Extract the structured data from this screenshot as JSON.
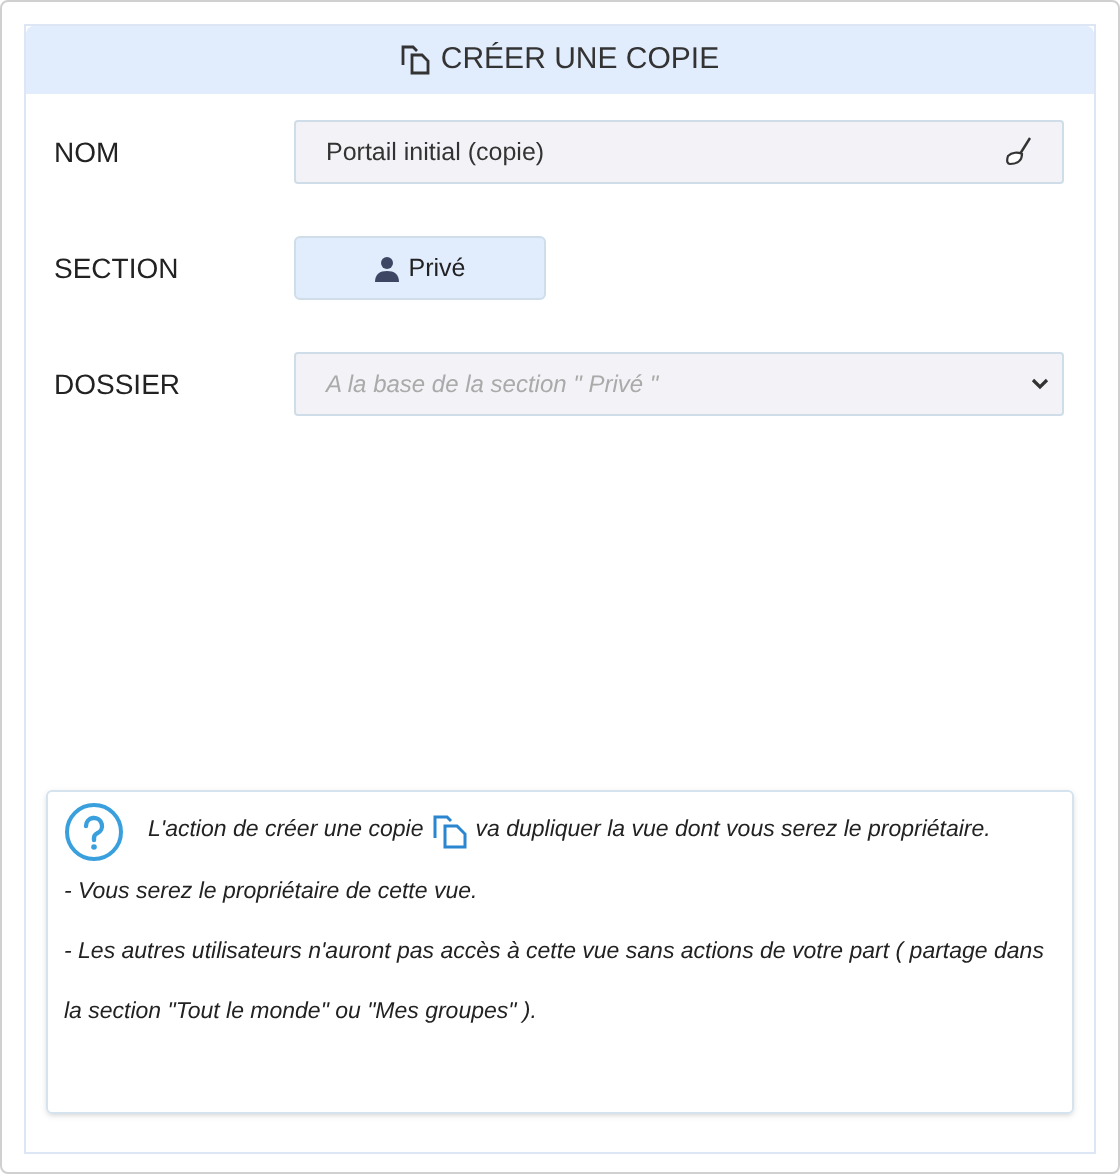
{
  "header": {
    "title": "CRÉER UNE COPIE"
  },
  "fields": [
    {
      "kind": "text",
      "label": "NOM",
      "value": "Portail initial (copie)"
    },
    {
      "kind": "button",
      "label": "SECTION",
      "value": "Privé"
    },
    {
      "kind": "select",
      "label": "DOSSIER",
      "placeholder": "A la base de la section \" Privé \""
    }
  ],
  "info": {
    "intro_before": "L'action de créer une copie",
    "intro_after": "va dupliquer la vue dont vous serez le propriétaire.",
    "lines": [
      "- Vous serez le propriétaire de cette vue.",
      "- Les autres utilisateurs n'auront pas accès à cette vue sans actions de votre part ( partage dans la section \"Tout le monde\" ou \"Mes groupes\" )."
    ]
  }
}
